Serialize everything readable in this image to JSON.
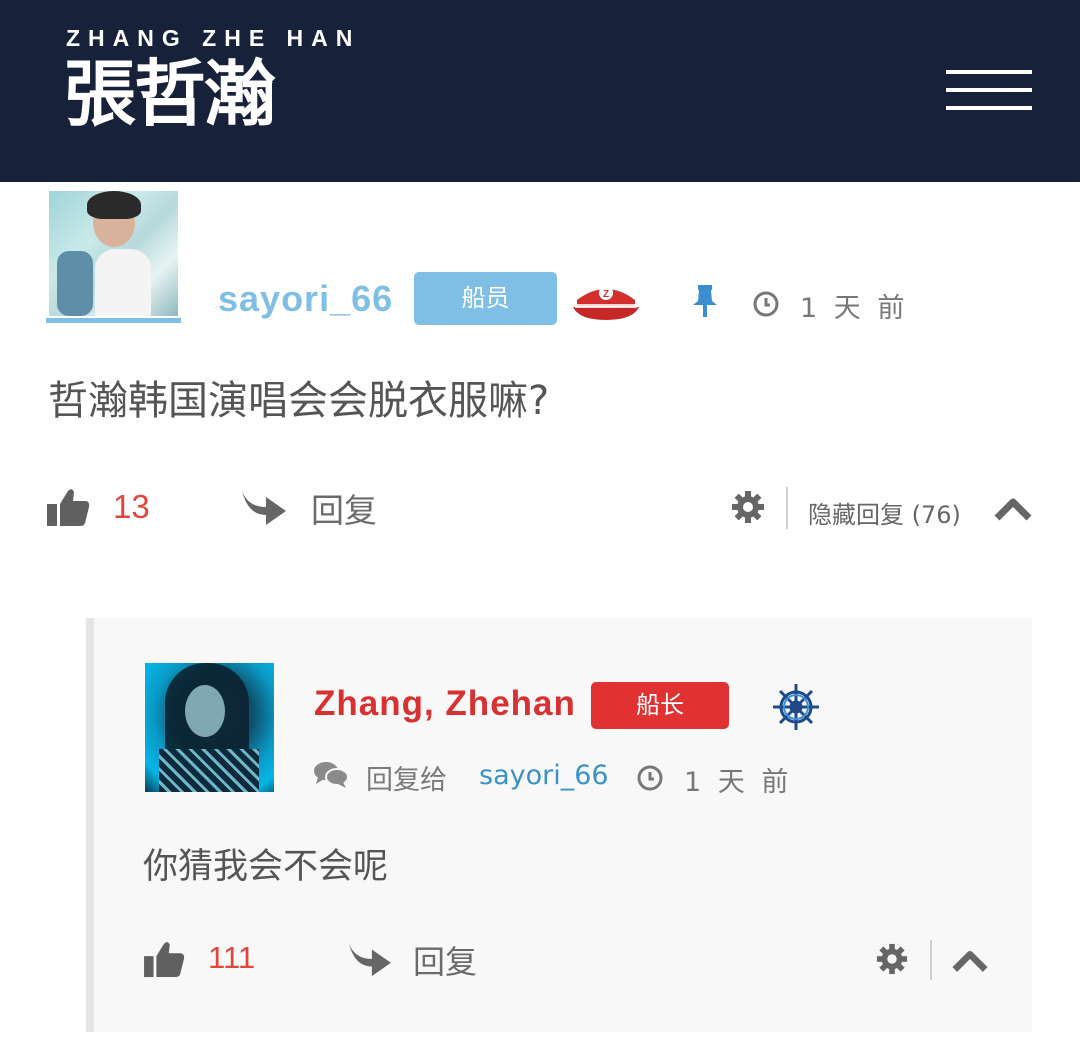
{
  "header": {
    "logo_latin": "ZHANG ZHE HAN",
    "logo_chinese": "張哲瀚",
    "bg_color": "#17213a"
  },
  "post": {
    "username": "sayori_66",
    "role_badge": "船员",
    "role_color": "#7fbfe6",
    "icons": [
      "captain-hat-icon",
      "pin-icon",
      "clock-icon"
    ],
    "time": "1 天 前",
    "content": "哲瀚韩国演唱会会脱衣服嘛?",
    "likes": "13",
    "reply_label": "回复",
    "hidden_replies_label": "隐藏回复 (76)"
  },
  "reply": {
    "username": "Zhang, Zhehan",
    "role_badge": "船长",
    "role_color": "#e03232",
    "icons": [
      "ship-wheel-icon",
      "comments-icon",
      "clock-icon"
    ],
    "reply_to_label": "回复给",
    "reply_to_user": "sayori_66",
    "time": "1 天 前",
    "content": "你猜我会不会呢",
    "likes": "111",
    "reply_label": "回复"
  }
}
